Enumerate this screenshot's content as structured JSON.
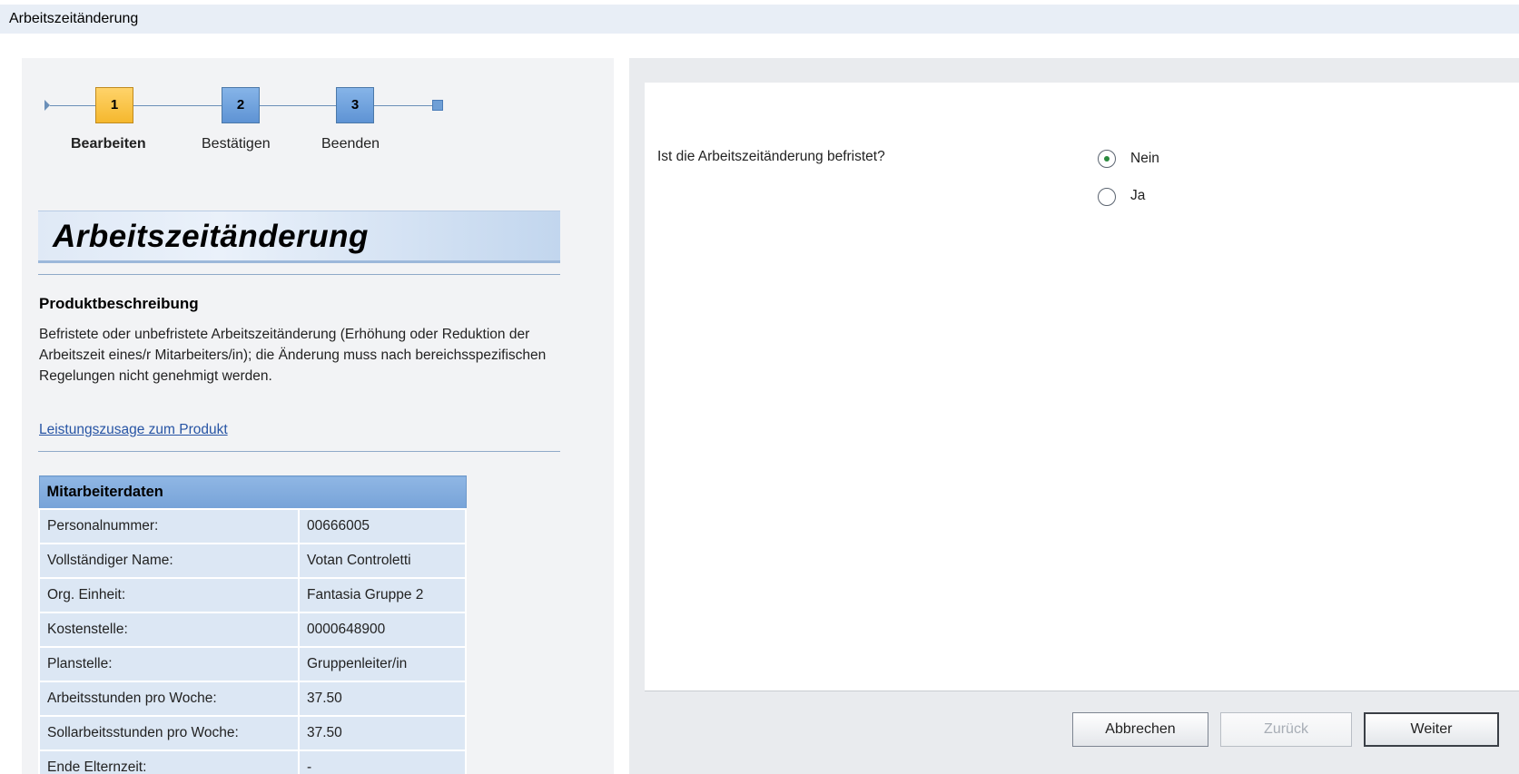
{
  "window": {
    "title": "Arbeitszeitänderung"
  },
  "roadmap": {
    "steps": [
      {
        "number": "1",
        "label": "Bearbeiten",
        "active": true
      },
      {
        "number": "2",
        "label": "Bestätigen",
        "active": false
      },
      {
        "number": "3",
        "label": "Beenden",
        "active": false
      }
    ]
  },
  "product": {
    "banner_title": "Arbeitszeitänderung",
    "heading": "Produktbeschreibung",
    "description": "Befristete oder unbefristete Arbeitszeitänderung (Erhöhung oder Reduktion der Arbeitszeit eines/r Mitarbeiters/in); die Änderung muss nach bereichsspezifischen Regelungen nicht genehmigt werden.",
    "link": "Leistungszusage zum Produkt"
  },
  "employee": {
    "header": "Mitarbeiterdaten",
    "rows": [
      {
        "label": "Personalnummer:",
        "value": "00666005"
      },
      {
        "label": "Vollständiger Name:",
        "value": "Votan Controletti"
      },
      {
        "label": "Org. Einheit:",
        "value": "Fantasia Gruppe 2"
      },
      {
        "label": "Kostenstelle:",
        "value": "0000648900"
      },
      {
        "label": "Planstelle:",
        "value": "Gruppenleiter/in"
      },
      {
        "label": "Arbeitsstunden pro Woche:",
        "value": "37.50"
      },
      {
        "label": "Sollarbeitsstunden pro Woche:",
        "value": "37.50"
      },
      {
        "label": "Ende Elternzeit:",
        "value": "-"
      }
    ]
  },
  "form": {
    "question": "Ist die Arbeitszeitänderung befristet?",
    "options": [
      {
        "label": "Nein",
        "selected": true
      },
      {
        "label": "Ja",
        "selected": false
      }
    ]
  },
  "footer": {
    "cancel_label": "Abbrechen",
    "back_label": "Zurück",
    "next_label": "Weiter"
  }
}
